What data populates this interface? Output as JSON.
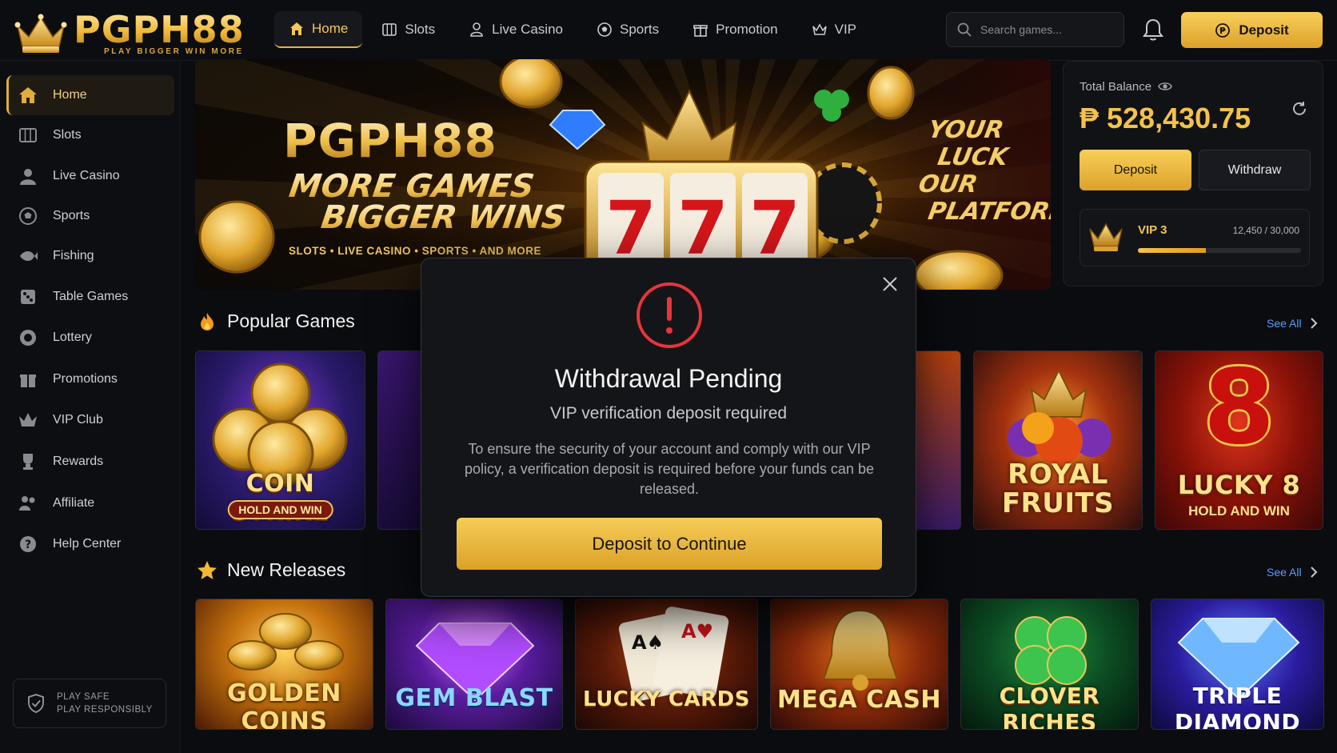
{
  "brand": {
    "name": "PGPH88",
    "tagline": "PLAY BIGGER WIN MORE"
  },
  "nav": [
    {
      "label": "Home",
      "icon": "home-icon",
      "active": true
    },
    {
      "label": "Slots",
      "icon": "slots-icon"
    },
    {
      "label": "Live Casino",
      "icon": "live-casino-icon"
    },
    {
      "label": "Sports",
      "icon": "soccer-ball-icon"
    },
    {
      "label": "Promotion",
      "icon": "gift-icon"
    },
    {
      "label": "VIP",
      "icon": "crown-icon"
    }
  ],
  "search": {
    "placeholder": "Search games..."
  },
  "header": {
    "deposit_label": "Deposit"
  },
  "sidebar": {
    "items": [
      {
        "label": "Home",
        "icon": "home-icon",
        "active": true
      },
      {
        "label": "Slots",
        "icon": "slot-machine-icon"
      },
      {
        "label": "Live Casino",
        "icon": "dealer-icon"
      },
      {
        "label": "Sports",
        "icon": "soccer-ball-icon"
      },
      {
        "label": "Fishing",
        "icon": "fish-icon"
      },
      {
        "label": "Table Games",
        "icon": "dice-icon"
      },
      {
        "label": "Lottery",
        "icon": "lottery-ball-icon"
      },
      {
        "label": "Promotions",
        "icon": "gift-icon"
      },
      {
        "label": "VIP Club",
        "icon": "crown-icon"
      },
      {
        "label": "Rewards",
        "icon": "trophy-icon"
      },
      {
        "label": "Affiliate",
        "icon": "people-icon"
      },
      {
        "label": "Help Center",
        "icon": "help-icon"
      }
    ],
    "play_safe_line1": "PLAY SAFE",
    "play_safe_line2": "PLAY RESPONSIBLY"
  },
  "banner": {
    "title": "PGPH88",
    "line1": "MORE GAMES",
    "line2": "BIGGER WINS",
    "tags": "SLOTS • LIVE CASINO • SPORTS • AND MORE",
    "right_text": [
      "YOUR",
      "LUCK",
      "OUR",
      "PLATFORM"
    ],
    "reels": [
      "7",
      "7",
      "7"
    ]
  },
  "balance": {
    "label": "Total Balance",
    "amount": "₱ 528,430.75",
    "deposit_label": "Deposit",
    "withdraw_label": "Withdraw",
    "vip_level": "VIP 3",
    "vip_progress_text": "12,450 / 30,000",
    "vip_progress_fraction": 0.415
  },
  "popular": {
    "title": "Popular Games",
    "see_all": "See All",
    "games": [
      {
        "name": "COIN STRIKE",
        "badge": "HOLD AND WIN"
      },
      {
        "name": "ROYAL FRUITS"
      },
      {
        "name": "LUCKY 8",
        "badge": "HOLD AND WIN"
      }
    ]
  },
  "releases": {
    "title": "New Releases",
    "see_all": "See All",
    "games": [
      {
        "name": "GOLDEN COINS"
      },
      {
        "name": "GEM BLAST"
      },
      {
        "name": "LUCKY CARDS"
      },
      {
        "name": "MEGA CASH"
      },
      {
        "name": "CLOVER RICHES"
      },
      {
        "name": "TRIPLE DIAMOND"
      }
    ]
  },
  "modal": {
    "title": "Withdrawal Pending",
    "subtitle": "VIP verification deposit required",
    "body": "To ensure the security of your account and comply with our VIP policy, a verification deposit is required before your funds can be released.",
    "button": "Deposit to Continue"
  },
  "colors": {
    "accent": "#f0b93a",
    "background": "#0b0c10",
    "alert": "#e8343c",
    "link": "#5c9cff"
  }
}
